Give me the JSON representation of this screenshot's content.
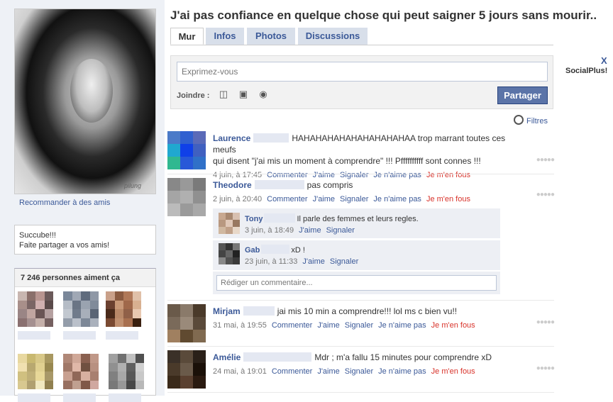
{
  "page_title": "J'ai pas confiance en quelque chose qui peut saigner 5 jours sans mourir..",
  "tabs": [
    "Mur",
    "Infos",
    "Photos",
    "Discussions"
  ],
  "sidebar": {
    "recommend": "Recommander à des amis",
    "bio_line1": "Succube!!!",
    "bio_line2": "Faite partager a vos amis!",
    "likes_title": "7 246 personnes aiment ça",
    "pic_signature": "pilung"
  },
  "composer": {
    "placeholder": "Exprimez-vous",
    "attach_label": "Joindre :",
    "share_label": "Partager"
  },
  "filters_label": "Filtres",
  "close_label": "X",
  "ad_label": "SocialPlus!",
  "posts": [
    {
      "name": "Laurence",
      "text_line1": "HAHAHAHAHAHAHAHAHAHAA trop marrant toutes ces meufs",
      "text_line2": "qui disent \"j'ai mis un moment à comprendre\" !!! Pffffffffff sont connes !!!",
      "time": "4 juin, à 17:45",
      "actions": [
        "Commenter",
        "J'aime",
        "Signaler",
        "Je n'aime pas",
        "Je m'en fous"
      ]
    },
    {
      "name": "Theodore",
      "text_line1": "pas compris",
      "time": "2 juin, à 20:40",
      "actions": [
        "Commenter",
        "J'aime",
        "Signaler",
        "Je n'aime pas",
        "Je m'en fous"
      ],
      "comments": [
        {
          "name": "Tony",
          "text": "Il parle des femmes et leurs regles.",
          "time": "3 juin, à 18:49",
          "actions": [
            "J'aime",
            "Signaler"
          ]
        },
        {
          "name": "Gab",
          "text": "xD !",
          "time": "23 juin, à 11:33",
          "actions": [
            "J'aime",
            "Signaler"
          ]
        }
      ],
      "comment_placeholder": "Rédiger un commentaire..."
    },
    {
      "name": "Mirjam",
      "text_line1": "jai mis 10 min a comprendre!!! lol ms c bien vu!!",
      "time": "31 mai, à 19:55",
      "actions": [
        "Commenter",
        "J'aime",
        "Signaler",
        "Je n'aime pas",
        "Je m'en fous"
      ]
    },
    {
      "name": "Amélie",
      "text_line1": "Mdr ; m'a fallu 15 minutes pour comprendre xD",
      "time": "24 mai, à 19:01",
      "actions": [
        "Commenter",
        "J'aime",
        "Signaler",
        "Je n'aime pas",
        "Je m'en fous"
      ]
    }
  ],
  "colors": {
    "link": "#3b5998",
    "red_action": "#d8322a",
    "share_button": "#5b74a8",
    "tab_bg": "#d8dfea"
  }
}
